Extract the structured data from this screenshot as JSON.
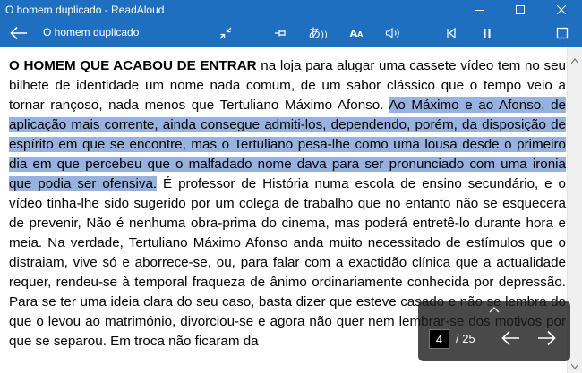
{
  "window": {
    "title": "O homem duplicado - ReadAloud"
  },
  "appbar": {
    "document_title": "O homem duplicado"
  },
  "text": {
    "lead": "O HOMEM QUE ACABOU DE ENTRAR",
    "before_highlight": " na loja para alugar uma cassete vídeo tem no seu bilhete de identidade um nome nada comum, de um sabor clássico que o tempo veio a tornar rançoso, nada menos que Tertuliano Máximo Afonso. ",
    "highlight": "Ao Máximo e ao Afonso, de aplicação mais corrente, ainda consegue admiti-los, dependendo, porém, da disposição de espírito em que se encontre, mas o Tertuliano pesa-lhe como uma lousa desde o primeiro dia em que percebeu que o malfadado nome dava para ser pronunciado com uma ironia que podia ser ofensiva.",
    "after_highlight": " É professor de História numa escola de ensino secundário, e o vídeo tinha-lhe sido sugerido por um colega de trabalho que no entanto não se esquecera de prevenir, Não é nenhuma obra-prima do cinema, mas poderá entretê-lo durante hora e meia. Na verdade, Tertuliano Máximo Afonso anda muito necessitado de estímulos que o distraiam, vive só e aborrece-se, ou, para falar com a exactidão clínica que a actualidade requer, rendeu-se à temporal fraqueza de ânimo ordinariamente conhecida por depressão. Para se ter uma ideia clara do seu caso, basta dizer que esteve casado e não se lembra do que o levou ao matrimónio, divorciou-se e agora não quer nem lembrar-se dos motivos por que se separou. Em troca não ficaram da"
  },
  "pager": {
    "current_page": "4",
    "total_label": "/ 25"
  },
  "colors": {
    "accent": "#1f6fc0",
    "highlight": "#98b2e0"
  }
}
